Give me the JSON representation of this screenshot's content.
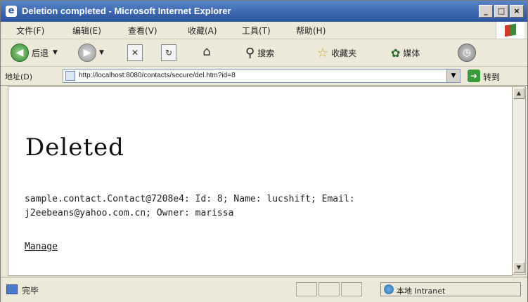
{
  "window": {
    "title": "Deletion completed - Microsoft Internet Explorer",
    "controls": [
      "_",
      "□",
      "×"
    ]
  },
  "menu": {
    "items": [
      "文件(F)",
      "编辑(E)",
      "查看(V)",
      "收藏(A)",
      "工具(T)",
      "帮助(H)"
    ]
  },
  "toolbar": {
    "back_label": "后退",
    "search_label": "搜索",
    "favorites_label": "收藏夹",
    "media_label": "媒体"
  },
  "address": {
    "label": "地址(D)",
    "url": "http://localhost:8080/contacts/secure/del.htm?id=8",
    "go_label": "转到"
  },
  "page": {
    "heading": "Deleted",
    "details_line1": "sample.contact.Contact@7208e4: Id: 8; Name: lucshift; Email:",
    "details_line2": "j2eebeans@yahoo.com.cn; Owner: marissa",
    "manage_link": "Manage"
  },
  "status": {
    "text": "完毕",
    "zone": "本地 Intranet"
  }
}
